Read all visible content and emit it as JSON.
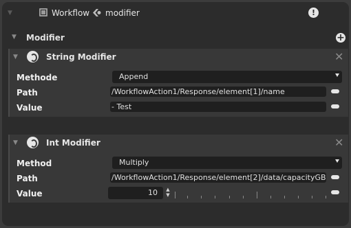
{
  "breadcrumb": {
    "workflow_label": "Workflow",
    "modifier_label": "modifier"
  },
  "section": {
    "title": "Modifier"
  },
  "string_modifier": {
    "title": "String Modifier",
    "method_label": "Methode",
    "method_value": "Append",
    "path_label": "Path",
    "path_value": "/WorkflowAction1/Response/element[1]/name",
    "value_label": "Value",
    "value_value": "- Test"
  },
  "int_modifier": {
    "title": "Int Modifier",
    "method_label": "Method",
    "method_value": "Multiply",
    "path_label": "Path",
    "path_value": "/WorkflowAction1/Response/element[2]/data/capacityGB",
    "value_label": "Value",
    "value_value": "10"
  },
  "icons": [
    "collapse-triangle",
    "workflow-icon",
    "modifier-icon",
    "info-icon",
    "add-icon",
    "close-icon",
    "remove-icon",
    "spinner-arrows"
  ],
  "colors": {
    "panel": "#2c2c2c",
    "card": "#383838",
    "field": "#1f1f1f",
    "text": "#e6e6e6"
  }
}
